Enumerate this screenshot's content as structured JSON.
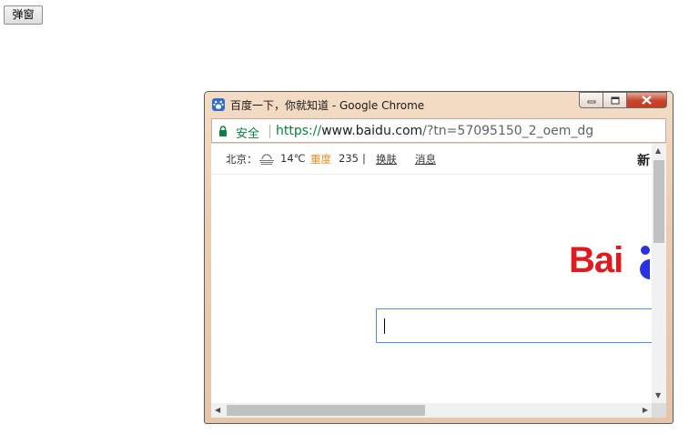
{
  "page": {
    "popup_button_label": "弹窗"
  },
  "window": {
    "title": "百度一下，你就知道 - Google Chrome",
    "favicon": "baidu-paw-icon",
    "controls": [
      "minimize-icon",
      "maximize-icon",
      "close-icon"
    ]
  },
  "address_bar": {
    "secure_label": "安全",
    "url_scheme": "https://",
    "url_host": "www.baidu.com",
    "url_path": "/?tn=57095150_2_oem_dg"
  },
  "baidu": {
    "city": "北京：",
    "weather_icon": "haze-weather-icon",
    "temperature": "14℃",
    "air_quality_label": "重度",
    "air_quality_value": "235",
    "divider": "|",
    "skin_link": "换肤",
    "news_link": "消息",
    "right_cut_text": "新",
    "logo_text": "Bai"
  },
  "colors": {
    "baidu_red": "#de1c20",
    "baidu_blue": "#2932e1",
    "secure_green": "#0b8043",
    "aqi_orange": "#e8891b",
    "search_border": "#4791ff"
  }
}
